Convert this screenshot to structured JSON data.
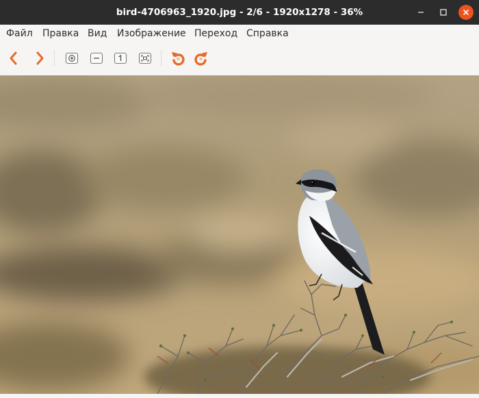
{
  "window": {
    "title": "bird-4706963_1920.jpg - 2/6 - 1920x1278 - 36%",
    "controls": {
      "minimize": "–",
      "maximize": "□",
      "close": "×"
    }
  },
  "menu": [
    {
      "label": "Файл"
    },
    {
      "label": "Правка"
    },
    {
      "label": "Вид"
    },
    {
      "label": "Изображение"
    },
    {
      "label": "Переход"
    },
    {
      "label": "Справка"
    }
  ],
  "toolbar": {
    "buttons": [
      {
        "icon": "chevron-left-icon",
        "action": "previous-image"
      },
      {
        "icon": "chevron-right-icon",
        "action": "next-image"
      },
      {
        "icon": "zoom-in-icon",
        "action": "zoom-in"
      },
      {
        "icon": "zoom-out-icon",
        "action": "zoom-out"
      },
      {
        "icon": "zoom-original-icon",
        "action": "original-size"
      },
      {
        "icon": "zoom-fit-icon",
        "action": "best-fit"
      },
      {
        "icon": "rotate-left-icon",
        "action": "rotate-left"
      },
      {
        "icon": "rotate-right-icon",
        "action": "rotate-right"
      }
    ],
    "accent_color": "#e66a2c"
  },
  "image": {
    "subject": "shrike-bird-on-thorny-shrub",
    "background_color": "#b29f78"
  }
}
